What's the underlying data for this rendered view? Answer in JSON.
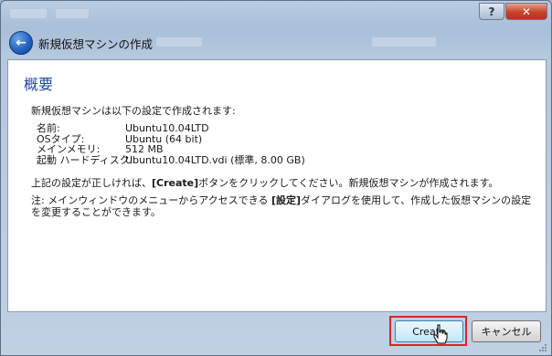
{
  "window": {
    "help_label": "?",
    "close_label": "✕"
  },
  "header": {
    "title": "新規仮想マシンの作成",
    "back_icon": "back-arrow-icon"
  },
  "content": {
    "heading": "概要",
    "intro": "新規仮想マシンは以下の設定で作成されます:",
    "summary": [
      {
        "label": "名前:",
        "value": "Ubuntu10.04LTD"
      },
      {
        "label": "OSタイプ:",
        "value": "Ubuntu (64 bit)"
      },
      {
        "label": "メインメモリ:",
        "value": "512 MB"
      },
      {
        "label": "起動 ハードディスク:",
        "value": "Ubuntu10.04LTD.vdi (標準, 8.00 GB)"
      }
    ],
    "confirm_pre": "上記の設定が正しければ、",
    "confirm_bold": "[Create]",
    "confirm_post": "ボタンをクリックしてください。新規仮想マシンが作成されます。",
    "note_pre": "注: メインウィンドウのメニューからアクセスできる ",
    "note_bold": "[設定]",
    "note_post": "ダイアログを使用して、作成した仮想マシンの設定を変更することができます。"
  },
  "buttons": {
    "create": "Create",
    "cancel": "キャンセル"
  },
  "colors": {
    "accent": "#1d4aa0",
    "highlight": "#d9262c"
  }
}
